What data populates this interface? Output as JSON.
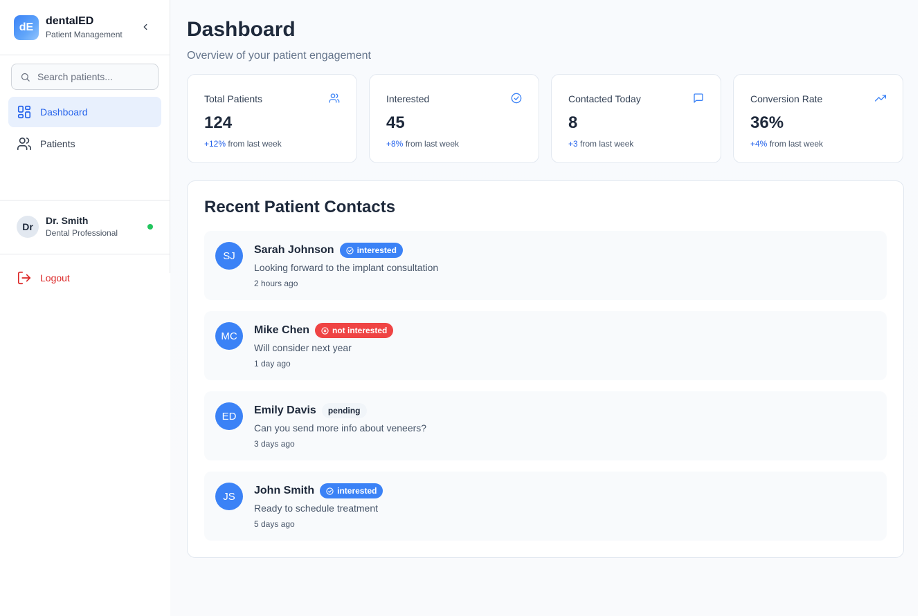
{
  "brand": {
    "logo_text": "dE",
    "name": "dentalED",
    "subtitle": "Patient Management"
  },
  "search": {
    "placeholder": "Search patients..."
  },
  "nav": {
    "items": [
      {
        "label": "Dashboard",
        "icon": "dashboard-grid-icon",
        "active": true
      },
      {
        "label": "Patients",
        "icon": "users-icon",
        "active": false
      }
    ]
  },
  "profile": {
    "initials": "Dr",
    "name": "Dr. Smith",
    "role": "Dental Professional",
    "status_color": "#22c55e"
  },
  "logout": {
    "label": "Logout",
    "icon": "logout-icon"
  },
  "page": {
    "title": "Dashboard",
    "subtitle": "Overview of your patient engagement"
  },
  "stats": [
    {
      "label": "Total Patients",
      "value": "124",
      "delta": "+12%",
      "delta_suffix": " from last week",
      "icon": "users-icon"
    },
    {
      "label": "Interested",
      "value": "45",
      "delta": "+8%",
      "delta_suffix": " from last week",
      "icon": "check-circle-icon"
    },
    {
      "label": "Contacted Today",
      "value": "8",
      "delta": "+3",
      "delta_suffix": " from last week",
      "icon": "message-square-icon"
    },
    {
      "label": "Conversion Rate",
      "value": "36%",
      "delta": "+4%",
      "delta_suffix": " from last week",
      "icon": "trending-up-icon"
    }
  ],
  "recent": {
    "title": "Recent Patient Contacts",
    "contacts": [
      {
        "initials": "SJ",
        "name": "Sarah Johnson",
        "status": "interested",
        "message": "Looking forward to the implant consultation",
        "time": "2 hours ago"
      },
      {
        "initials": "MC",
        "name": "Mike Chen",
        "status": "not interested",
        "message": "Will consider next year",
        "time": "1 day ago"
      },
      {
        "initials": "ED",
        "name": "Emily Davis",
        "status": "pending",
        "message": "Can you send more info about veneers?",
        "time": "3 days ago"
      },
      {
        "initials": "JS",
        "name": "John Smith",
        "status": "interested",
        "message": "Ready to schedule treatment",
        "time": "5 days ago"
      }
    ]
  },
  "colors": {
    "accent": "#3b82f6",
    "accent_dark": "#2563eb",
    "danger": "#ef4444",
    "logout": "#dc2626",
    "online": "#22c55e"
  }
}
